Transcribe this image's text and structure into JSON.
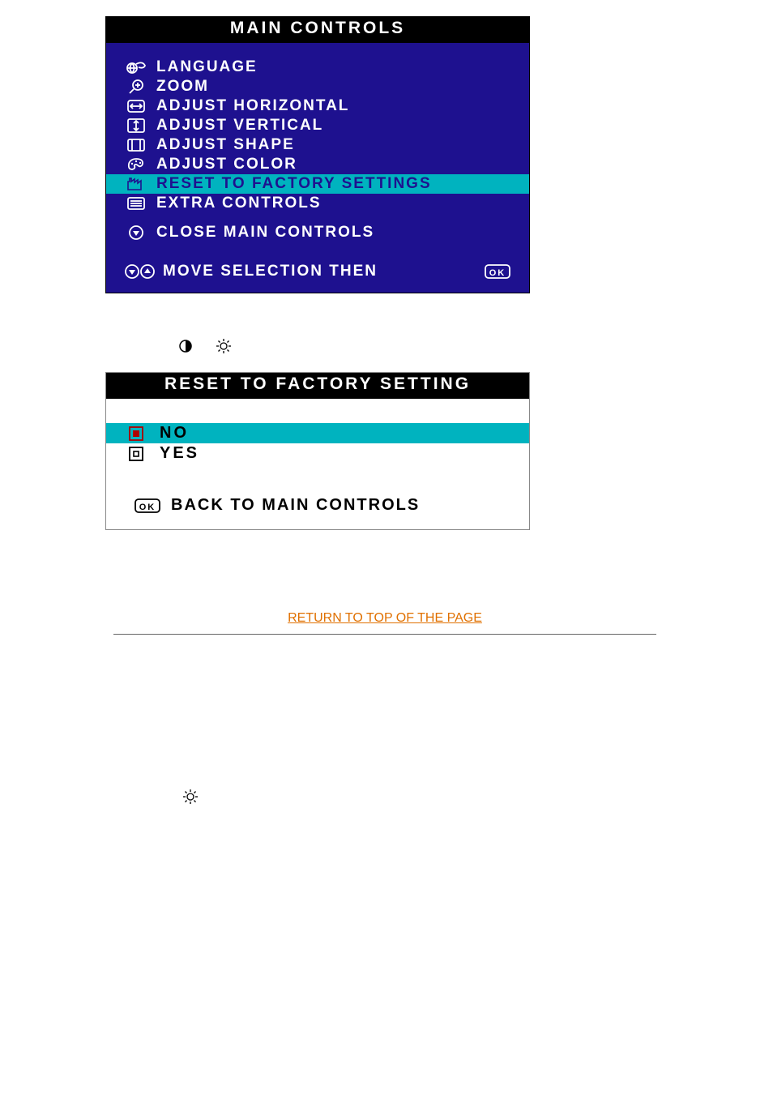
{
  "main": {
    "title": "MAIN CONTROLS",
    "items": {
      "language": "LANGUAGE",
      "zoom": "ZOOM",
      "adjust_horizontal": "ADJUST HORIZONTAL",
      "adjust_vertical": "ADJUST VERTICAL",
      "adjust_shape": "ADJUST SHAPE",
      "adjust_color": "ADJUST COLOR",
      "reset_factory": "RESET TO FACTORY SETTINGS",
      "extra_controls": "EXTRA CONTROLS",
      "close": "CLOSE MAIN CONTROLS"
    },
    "footer": "MOVE SELECTION THEN"
  },
  "reset": {
    "title": "RESET TO FACTORY SETTING",
    "no": "NO",
    "yes": "YES",
    "back": "BACK TO MAIN CONTROLS"
  },
  "link": {
    "label": "RETURN TO TOP OF THE PAGE"
  }
}
